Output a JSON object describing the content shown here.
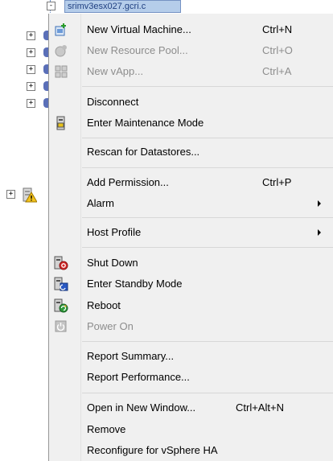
{
  "tree": {
    "selected_label": "srimv3esx027.gcri.c"
  },
  "menu": {
    "items": [
      {
        "label": "New Virtual Machine...",
        "shortcut": "Ctrl+N",
        "icon": "new-vm-icon"
      },
      {
        "label": "New Resource Pool...",
        "shortcut": "Ctrl+O",
        "icon": "resource-pool-icon",
        "disabled": true
      },
      {
        "label": "New vApp...",
        "shortcut": "Ctrl+A",
        "icon": "vapp-icon",
        "disabled": true
      },
      {
        "label": "Disconnect"
      },
      {
        "label": "Enter Maintenance Mode",
        "icon": "maintenance-icon"
      },
      {
        "label": "Rescan for Datastores..."
      },
      {
        "label": "Add Permission...",
        "shortcut": "Ctrl+P"
      },
      {
        "label": "Alarm",
        "submenu": true
      },
      {
        "label": "Host Profile",
        "submenu": true
      },
      {
        "label": "Shut Down",
        "icon": "shutdown-icon"
      },
      {
        "label": "Enter Standby Mode",
        "icon": "standby-icon"
      },
      {
        "label": "Reboot",
        "icon": "reboot-icon"
      },
      {
        "label": "Power On",
        "icon": "power-on-icon",
        "disabled": true
      },
      {
        "label": "Report Summary..."
      },
      {
        "label": "Report Performance..."
      },
      {
        "label": "Open in New Window...",
        "shortcut": "Ctrl+Alt+N"
      },
      {
        "label": "Remove"
      },
      {
        "label": "Reconfigure for vSphere HA"
      }
    ]
  },
  "colors": {
    "menu_bg": "#f0f0f0",
    "disabled_text": "#8d8d8d",
    "selection_bg": "#b5cdea"
  }
}
